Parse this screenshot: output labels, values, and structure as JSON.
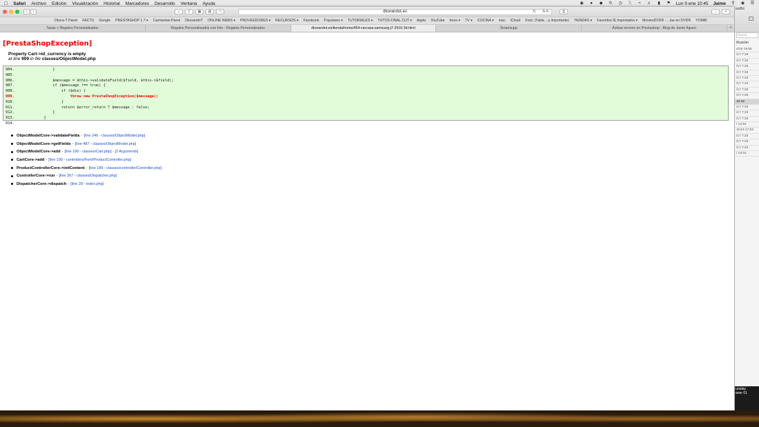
{
  "menubar": {
    "app": "Safari",
    "items": [
      "Archivo",
      "Edición",
      "Visualización",
      "Historial",
      "Marcadores",
      "Desarrollo",
      "Ventana",
      "Ayuda"
    ],
    "clock": "Lun 9 ene  10:45",
    "user": "Jaime"
  },
  "browser": {
    "address": "dkorandot.es",
    "bookmarks": [
      "Dkora-T Panel",
      "FACTU",
      "Google",
      "PRESTASHOP 1.7 ▾",
      "Camisetas-Panel",
      "DkorandoT",
      "ONLINE WEBS ▾",
      "PROVEEDORES ▾",
      "RECURSOS ▾",
      "Facebook",
      "Populares ▾",
      "TUTORIALES ▾",
      "TUTOS FINAL CUT ▾",
      "Apple",
      "YouTube",
      "force ▾",
      "TV ▾",
      "COCINA ▾",
      "mac",
      "iCloud",
      "Foto: (Tabla ...y importante)",
      "TIENDAS ▾",
      "Favoritos IE importados ▾",
      "MoviesDVDR - ...las en DVDR",
      "YOMBI"
    ],
    "tabs": [
      {
        "label": "Tazas + Regalos Personalizados",
        "active": false
      },
      {
        "label": "Regalos Personalizados con foto - Regalos Personalizados",
        "active": false
      },
      {
        "label": "dkorandot.es/tienda/home/454-carcasa-samsung-j7-2016-3d.html",
        "active": true
      },
      {
        "label": "Smartsupp",
        "active": false
      },
      {
        "label": "Activar errores en Prestashop - Blog de Javier figueo",
        "active": false
      }
    ]
  },
  "error": {
    "title": "[PrestaShopException]",
    "message": "Property Cart->id_currency is empty",
    "at_line_prefix": "at line",
    "line": "909",
    "in_file_prefix": "in file",
    "file": "classes/ObjectModel.php"
  },
  "code": [
    {
      "ln": "904.",
      "text": "            }",
      "err": false
    },
    {
      "ln": "905.",
      "text": "",
      "err": false
    },
    {
      "ln": "906.",
      "text": "            $message = $this->validateField($field, $this->$field);",
      "err": false
    },
    {
      "ln": "907.",
      "text": "            if ($message !== true) {",
      "err": false
    },
    {
      "ln": "908.",
      "text": "                if ($die) {",
      "err": false
    },
    {
      "ln": "909.",
      "text": "                    throw new PrestaShopException($message);",
      "err": true
    },
    {
      "ln": "910.",
      "text": "                }",
      "err": false
    },
    {
      "ln": "911.",
      "text": "                return $error_return ? $message : false;",
      "err": false
    },
    {
      "ln": "912.",
      "text": "            }",
      "err": false
    },
    {
      "ln": "913.",
      "text": "        }",
      "err": false
    },
    {
      "ln": "914.",
      "text": "",
      "err": false
    }
  ],
  "trace": [
    {
      "fn": "ObjectModelCore->validateFields",
      "link": "[line 246 - classes/ObjectModel.php]"
    },
    {
      "fn": "ObjectModelCore->getFields",
      "link": "[line 487 - classes/ObjectModel.php]"
    },
    {
      "fn": "ObjectModelCore->add",
      "link": "[line 196 - classes/Cart.php] - [2 Arguments]"
    },
    {
      "fn": "CartCore->add",
      "link": "[line 190 - controllers/front/ProductController.php]"
    },
    {
      "fn": "ProductControllerCore->initContent",
      "link": "[line 189 - classes/controller/Controller.php]"
    },
    {
      "fn": "ControllerCore->run",
      "link": "[line 367 - classes/Dispatcher.php]"
    },
    {
      "fn": "DispatcherCore->dispatch",
      "link": "[line 28 - index.php]"
    }
  ],
  "trace_separator": "-",
  "sidewin": {
    "title": "isoBrt",
    "search_placeholder": "Buscar",
    "label": "ificación",
    "rows": [
      "4/15 19:05",
      "/17 7:33",
      "/17 7:33",
      "/17 7:33",
      "/17 7:33",
      "/17 7:33",
      "/17 7:33",
      "/17 7:33",
      "/17 7:33",
      "10:42",
      "/17 7:33",
      "/17 7:33",
      "/17 7:33",
      "/ 12:54",
      "11/16 17:02",
      "/17 7:33",
      "/17 7:33",
      "/17 7:33",
      "/ 13:01"
    ],
    "selected_index": 9,
    "bottom_text": "ursday",
    "bottom_text2": "aner 01"
  }
}
